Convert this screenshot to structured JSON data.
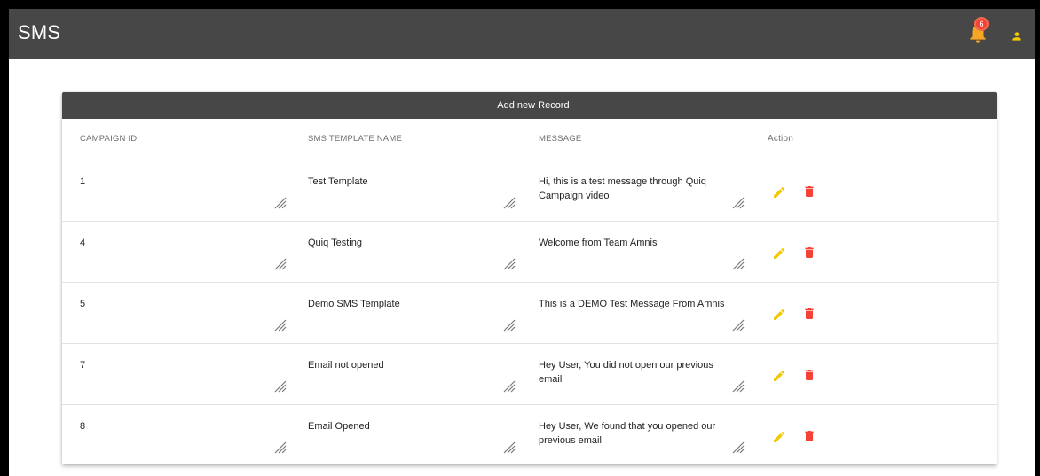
{
  "app": {
    "title": "SMS",
    "notification_count": "6"
  },
  "colors": {
    "header_bg": "#474747",
    "bell": "#f5a623",
    "badge": "#f44336",
    "edit": "#f3c800",
    "delete": "#f44336"
  },
  "table": {
    "add_label": "+ Add new Record",
    "columns": [
      "CAMPAIGN ID",
      "SMS TEMPLATE NAME",
      "MESSAGE",
      "Action"
    ],
    "rows": [
      {
        "id": "1",
        "name": "Test Template",
        "message": "Hi, this is a test message through Quiq Campaign video"
      },
      {
        "id": "4",
        "name": "Quiq Testing",
        "message": "Welcome from Team Amnis"
      },
      {
        "id": "5",
        "name": "Demo SMS Template",
        "message": "This is a DEMO Test Message From Amnis"
      },
      {
        "id": "7",
        "name": "Email not opened",
        "message": "Hey User, You did not open our previous email"
      },
      {
        "id": "8",
        "name": "Email Opened",
        "message": "Hey User, We found that you opened our previous email"
      }
    ]
  },
  "icons": {
    "bell": "bell-icon",
    "user": "user-icon",
    "edit": "pencil-icon",
    "delete": "trash-icon",
    "resize": "resize-grip-icon"
  }
}
